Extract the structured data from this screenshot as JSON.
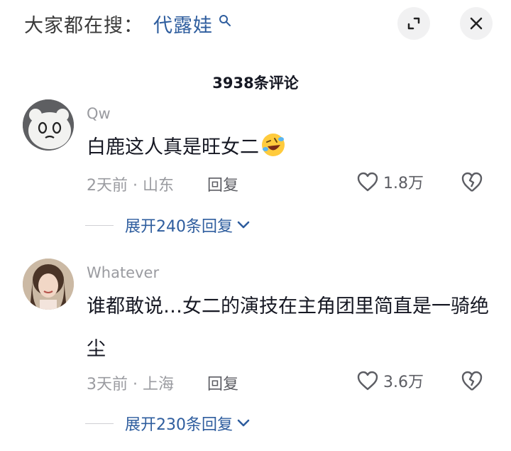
{
  "search": {
    "prefix": "大家都在搜：",
    "term": "代露娃"
  },
  "header": {
    "comment_count_label": "3938条评论"
  },
  "comments": [
    {
      "username": "Qw",
      "content": "白鹿这人真是旺女二",
      "emoji": "rolling-laughing-emoji",
      "time": "2天前",
      "location": "山东",
      "meta": "2天前 · 山东",
      "reply_label": "回复",
      "likes": "1.8万",
      "expand_label": "展开240条回复"
    },
    {
      "username": "Whatever",
      "content": "谁都敢说…女二的演技在主角团里简直是一骑绝尘",
      "time": "3天前",
      "location": "上海",
      "meta": "3天前 · 上海",
      "reply_label": "回复",
      "likes": "3.6万",
      "expand_label": "展开230条回复"
    }
  ],
  "colors": {
    "link_blue": "#2e5d9e",
    "muted_gray": "#9a9ba0",
    "text_dark": "#161823"
  }
}
